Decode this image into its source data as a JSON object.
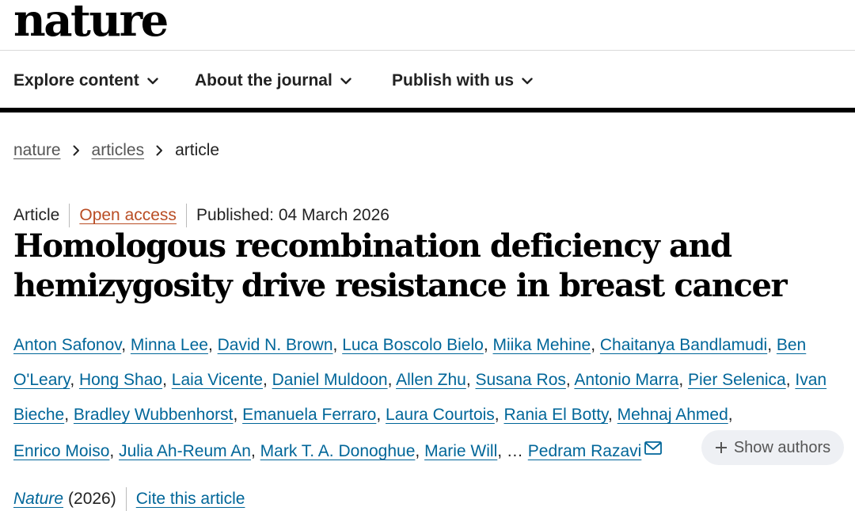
{
  "header": {
    "logo_text": "nature"
  },
  "nav": {
    "items": [
      {
        "label": "Explore content",
        "icon": "chevron-down-icon"
      },
      {
        "label": "About the journal",
        "icon": "chevron-down-icon"
      },
      {
        "label": "Publish with us",
        "icon": "chevron-down-icon"
      }
    ]
  },
  "breadcrumb": {
    "items": [
      "nature",
      "articles"
    ],
    "current": "article",
    "separator_icon": "chevron-right-icon"
  },
  "article": {
    "type": "Article",
    "access": "Open access",
    "published": "Published: 04 March 2026",
    "title_line1": "Homologous recombination deficiency and",
    "title_line2": "hemizygosity drive resistance in breast cancer",
    "authors": [
      "Anton Safonov",
      "Minna Lee",
      "David N. Brown",
      "Luca Boscolo Bielo",
      "Miika Mehine",
      "Chaitanya Bandlamudi",
      "Ben O'Leary",
      "Hong Shao",
      "Laia Vicente",
      "Daniel Muldoon",
      "Allen Zhu",
      "Susana Ros",
      "Antonio Marra",
      "Pier Selenica",
      "Ivan Bieche",
      "Bradley Wubbenhorst",
      "Emanuela Ferraro",
      "Laura Courtois",
      "Rania El Botty",
      "Mehnaj Ahmed",
      "Enrico Moiso",
      "Julia Ah-Reum An",
      "Mark T. A. Donoghue",
      "Marie Will"
    ],
    "ellipsis": "…",
    "corresponding_author": "Pedram Razavi",
    "mail_icon": "mail-icon",
    "show_authors_label": "Show authors",
    "journal": "Nature",
    "year": "(2026)",
    "cite_label": "Cite this article"
  },
  "colors": {
    "link": "#006699",
    "open_access": "#b94d24",
    "nav_border": "#000000",
    "show_authors_bg": "#eef0f4"
  }
}
